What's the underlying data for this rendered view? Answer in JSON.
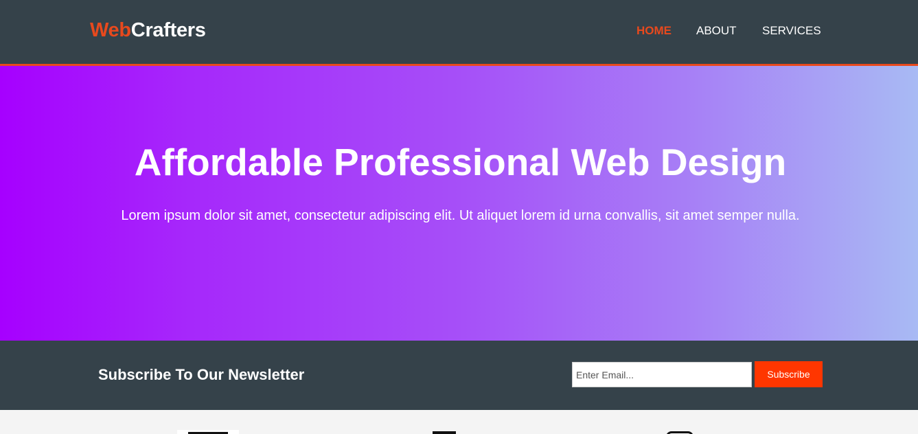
{
  "header": {
    "logo_highlight": "Web",
    "logo_rest": "Crafters",
    "nav": [
      {
        "label": "Home",
        "current": true
      },
      {
        "label": "About",
        "current": false
      },
      {
        "label": "Services",
        "current": false
      }
    ]
  },
  "hero": {
    "title": "Affordable Professional Web Design",
    "text": "Lorem ipsum dolor sit amet, consectetur adipiscing elit. Ut aliquet lorem id urna convallis, sit amet semper nulla."
  },
  "newsletter": {
    "heading": "Subscribe To Our Newsletter",
    "email_placeholder": "Enter Email...",
    "email_value": "",
    "button_label": "Subscribe"
  },
  "boxes": {
    "icons": [
      "html5-icon",
      "css3-icon",
      "brush-icon"
    ]
  },
  "colors": {
    "header_bg": "#35424a",
    "accent": "#e8491d",
    "button": "#ff3600",
    "hero_gradient_start": "#a600ff",
    "hero_gradient_end": "#a8baf4"
  }
}
